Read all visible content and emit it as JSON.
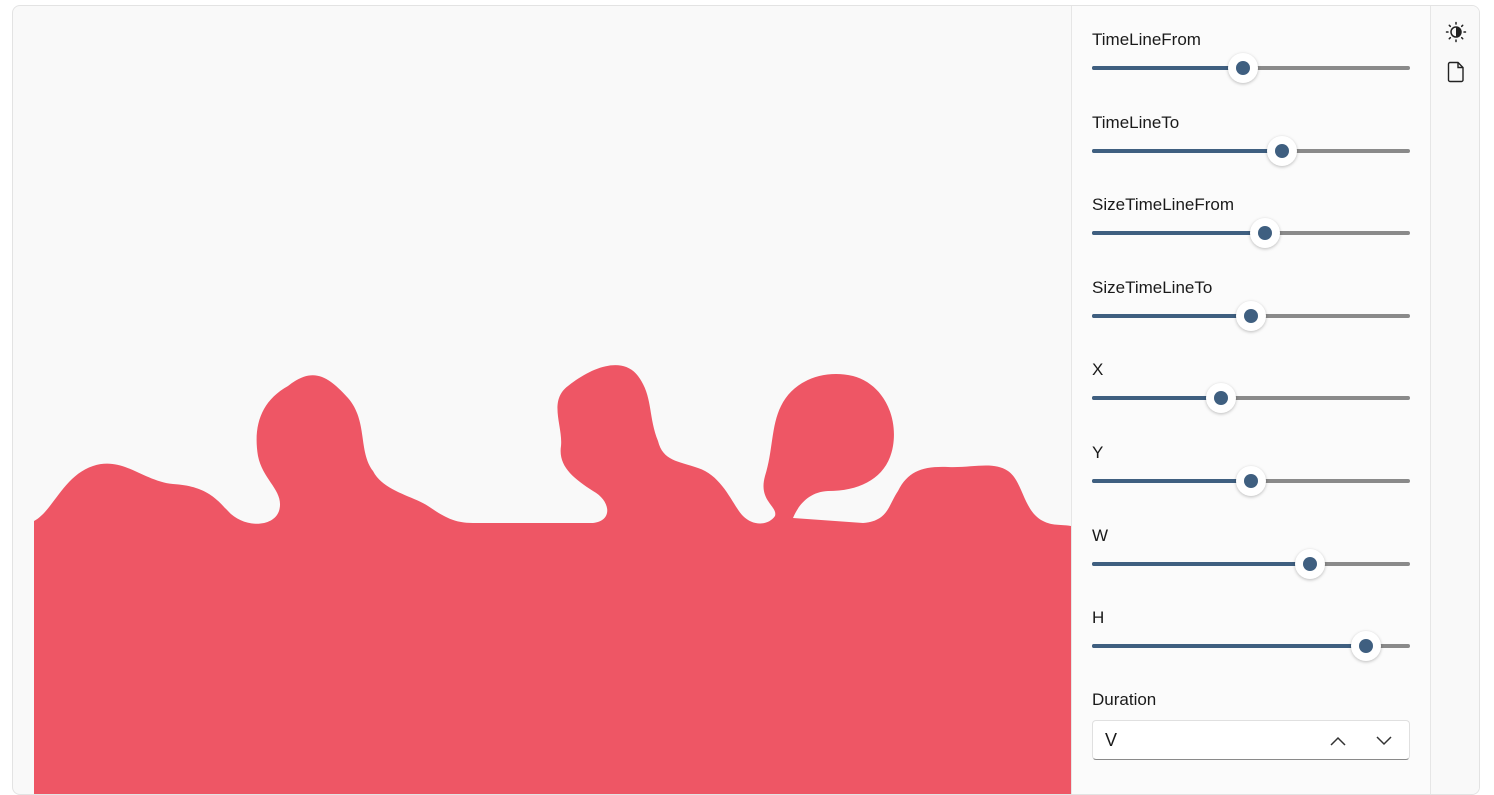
{
  "canvas": {
    "blob_color": "#ee5665",
    "background_color": "#f9f9f9"
  },
  "sliders": [
    {
      "label": "TimeLineFrom",
      "value": 0.475
    },
    {
      "label": "TimeLineTo",
      "value": 0.598
    },
    {
      "label": "SizeTimeLineFrom",
      "value": 0.545
    },
    {
      "label": "SizeTimeLineTo",
      "value": 0.5
    },
    {
      "label": "X",
      "value": 0.406
    },
    {
      "label": "Y",
      "value": 0.5
    },
    {
      "label": "W",
      "value": 0.685
    },
    {
      "label": "H",
      "value": 0.862
    }
  ],
  "duration": {
    "label": "Duration",
    "value": "V"
  },
  "toolbar": {
    "icons": [
      "theme-toggle-icon",
      "document-icon"
    ]
  },
  "accent_color": "#3f5f80"
}
